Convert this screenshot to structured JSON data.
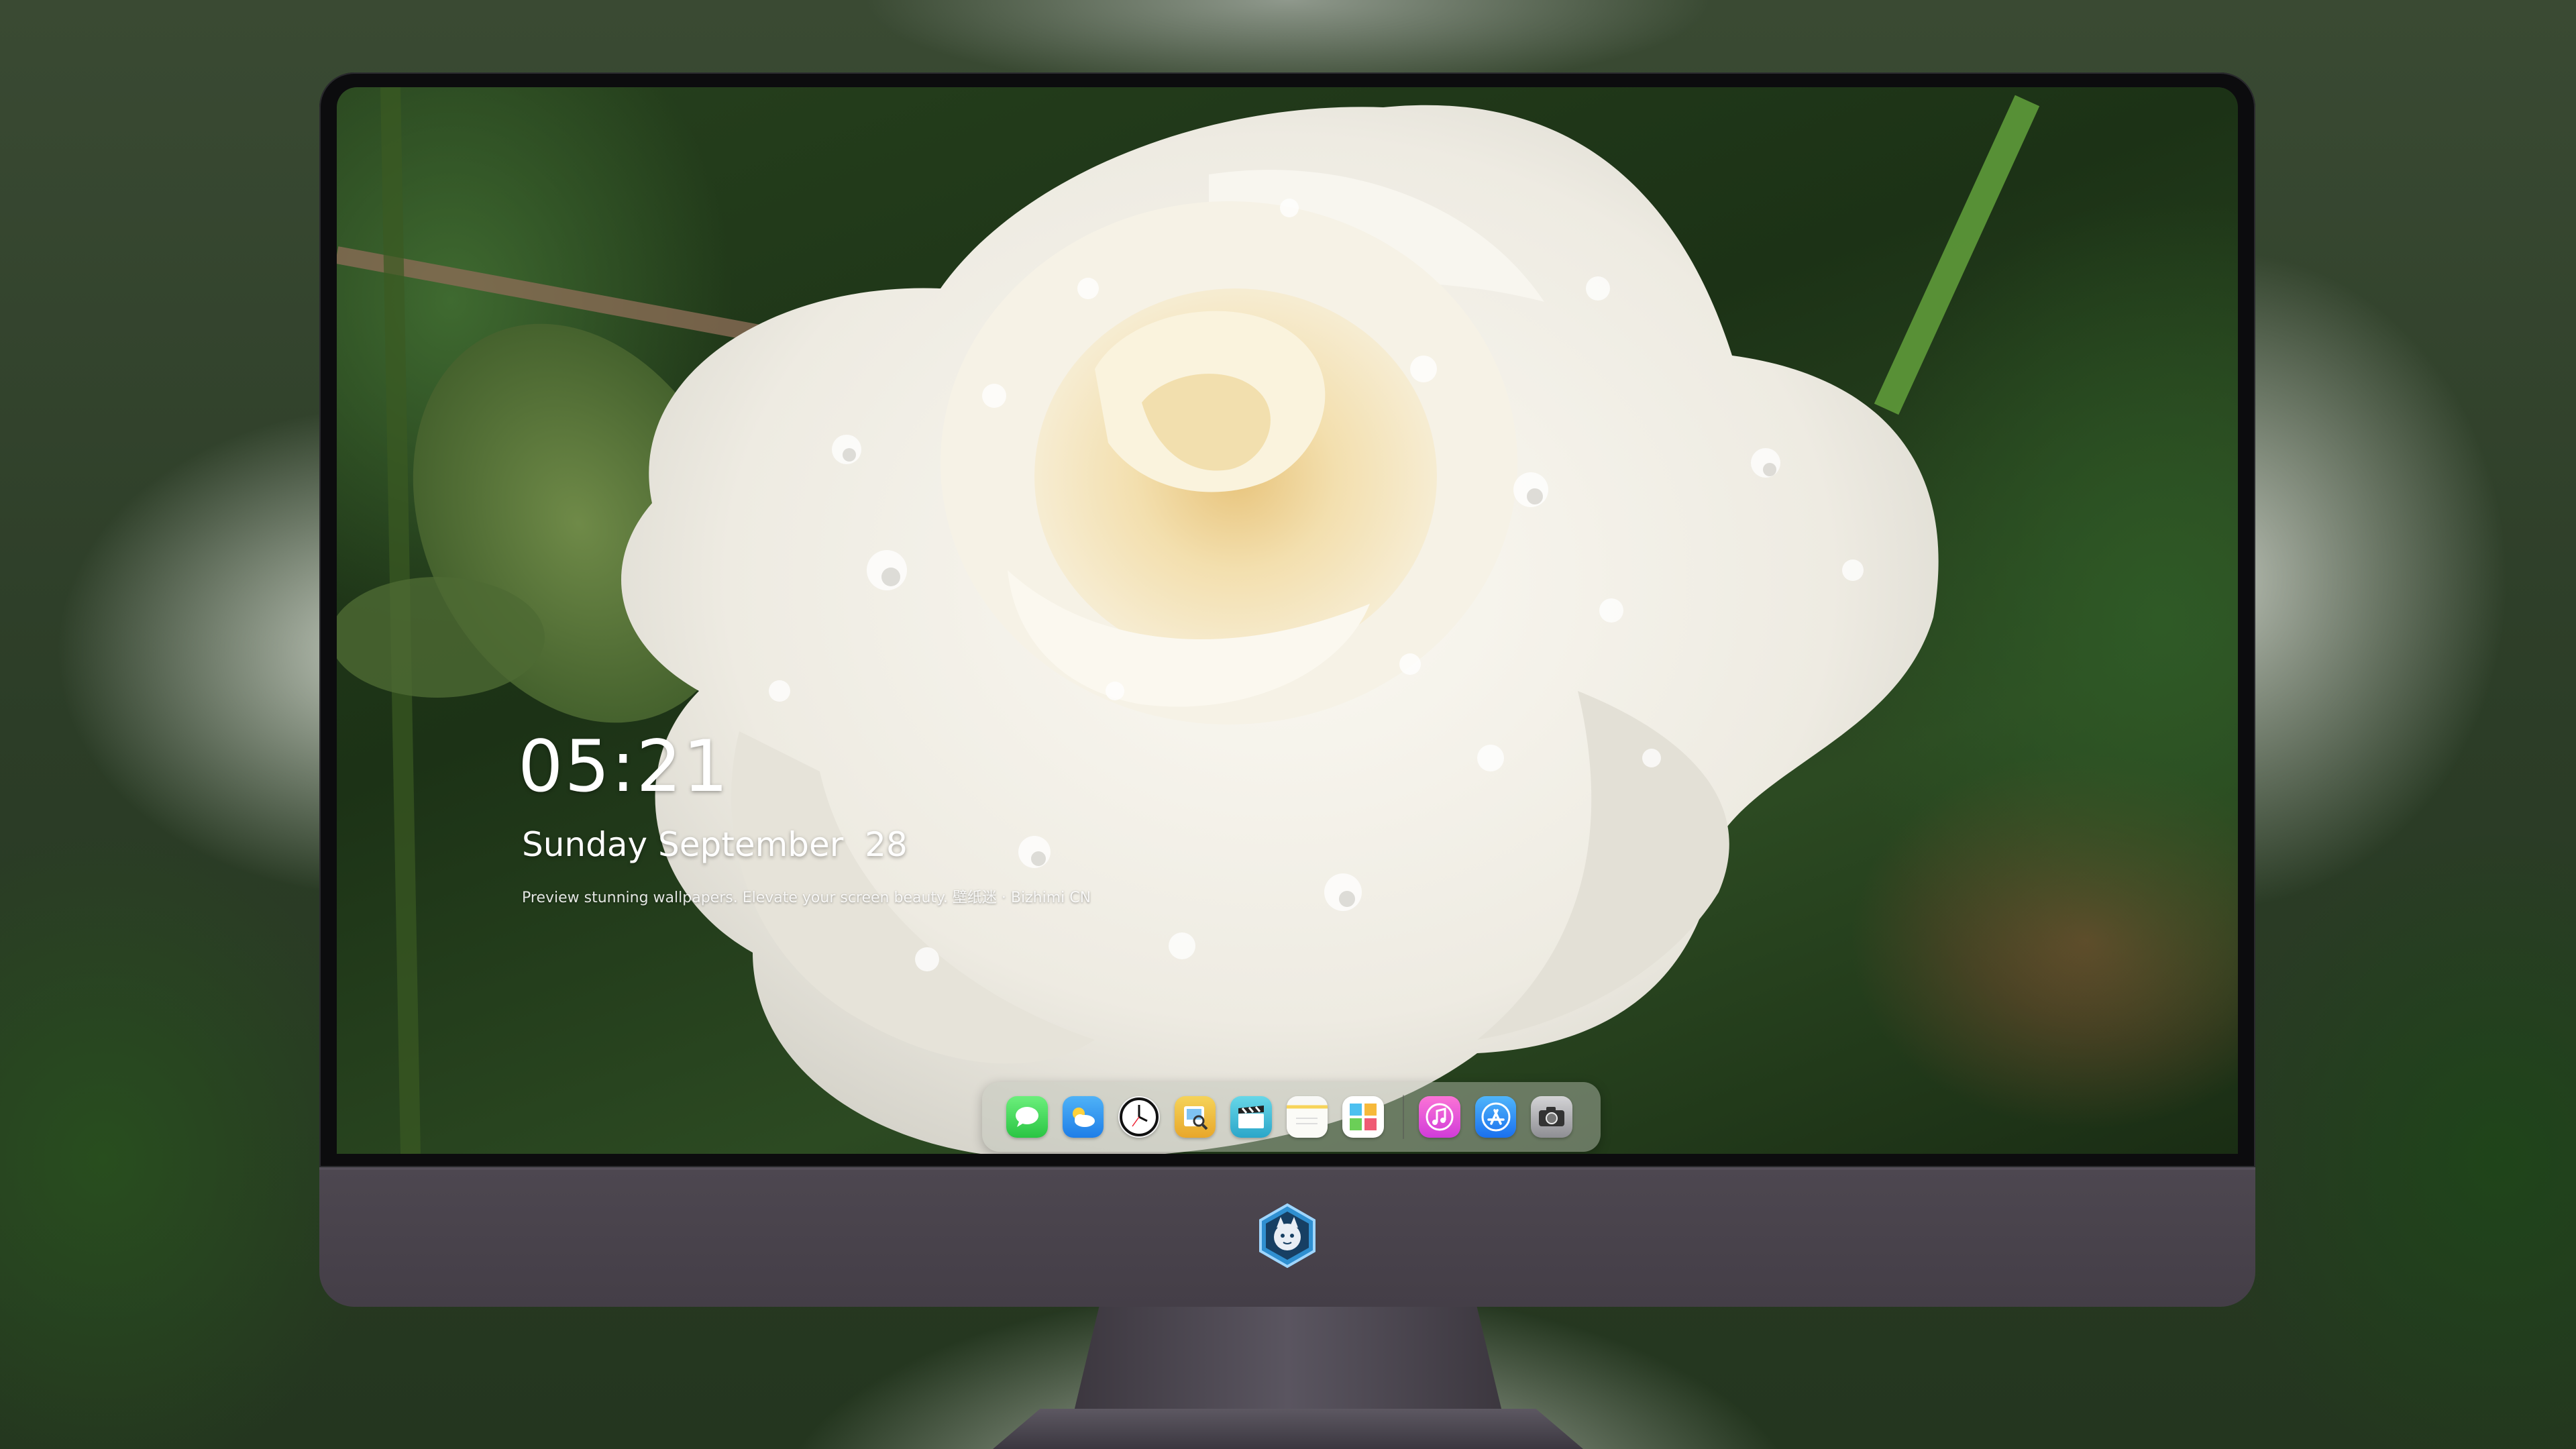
{
  "lockscreen": {
    "time": "05:21",
    "date": "Sunday September  28",
    "tagline": "Preview stunning wallpapers. Elevate your screen beauty. 壁纸迷 · Bizhimi CN"
  },
  "dock": {
    "apps": [
      {
        "name": "Messages",
        "icon": "messages-icon"
      },
      {
        "name": "Weather",
        "icon": "weather-icon"
      },
      {
        "name": "Clock",
        "icon": "clock-icon"
      },
      {
        "name": "Preview",
        "icon": "preview-icon"
      },
      {
        "name": "Clips",
        "icon": "clapperboard-icon"
      },
      {
        "name": "Notes",
        "icon": "notes-icon"
      },
      {
        "name": "Photos",
        "icon": "photos-icon"
      },
      {
        "name": "Music",
        "icon": "music-icon"
      },
      {
        "name": "App Store",
        "icon": "app-store-icon"
      },
      {
        "name": "Camera",
        "icon": "camera-icon"
      }
    ]
  },
  "colors": {
    "monitor_chin": "#4a444d",
    "bezel": "#0c0c0e",
    "text": "#ffffff",
    "rose": "#f4f2ea",
    "rose_center": "#f1dca8"
  }
}
